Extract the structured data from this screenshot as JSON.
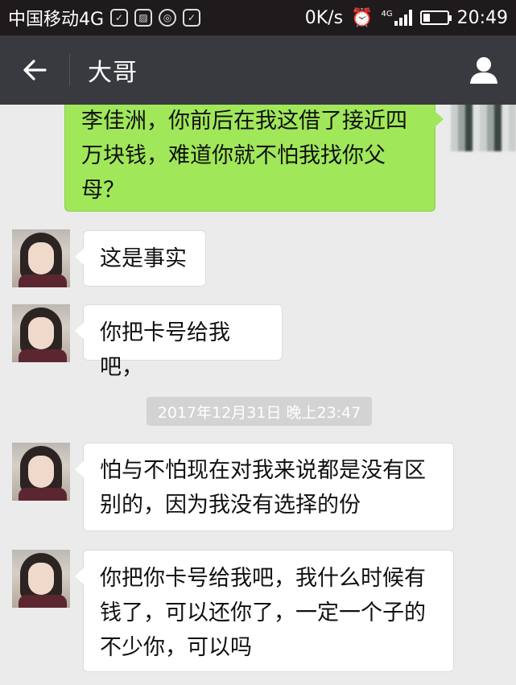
{
  "status_bar": {
    "carrier": "中国移动4G",
    "network_speed": "0K/s",
    "network_type": "4G",
    "time": "20:49",
    "icons": [
      "wechat-notification-icon",
      "image-notification-icon",
      "app-notification-icon",
      "wechat-notification-icon",
      "alarm-icon",
      "signal-icon",
      "battery-icon"
    ]
  },
  "header": {
    "back_icon": "back-arrow-icon",
    "title": "大哥",
    "profile_icon": "person-icon"
  },
  "messages": [
    {
      "side": "sent",
      "lines": [
        "李佳洲，你前后在我这借了接近四",
        "万块钱，难道你就不怕我找你父",
        "母？"
      ]
    },
    {
      "side": "received",
      "lines": [
        "这是事实"
      ]
    },
    {
      "side": "received",
      "lines": [
        "你把卡号给我吧，"
      ]
    },
    {
      "type": "timestamp",
      "text": "2017年12月31日 晚上23:47"
    },
    {
      "side": "received",
      "lines": [
        "怕与不怕现在对我来说都是没有区",
        "别的，因为我没有选择的份"
      ]
    },
    {
      "side": "received",
      "lines": [
        "你把你卡号给我吧，我什么时候有",
        "钱了，可以还你了，一定一个子的",
        "不少你，可以吗"
      ]
    }
  ],
  "colors": {
    "status_bar_bg": "#1f1a1b",
    "title_bar_bg": "#393a3f",
    "chat_bg": "#ebebeb",
    "sent_bubble": "#a0e75a",
    "received_bubble": "#ffffff"
  }
}
